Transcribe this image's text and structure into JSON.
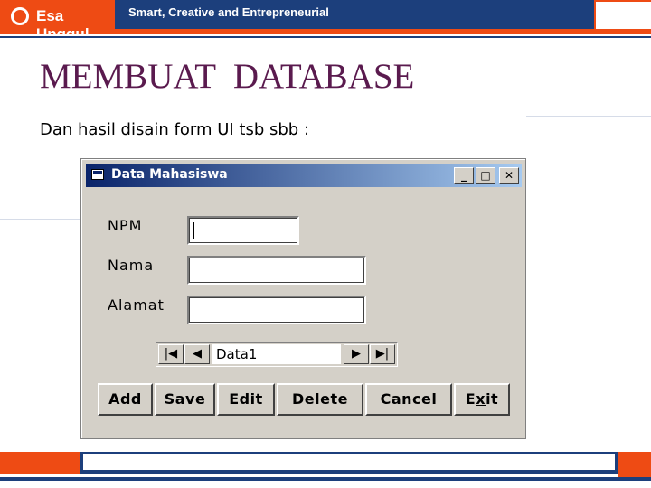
{
  "banner": {
    "logo_text": "Esa Unggul",
    "tagline": "Smart, Creative and Entrepreneurial"
  },
  "slide": {
    "title": "MEMBUAT  DATABASE",
    "body": "Dan hasil disain form UI tsb sbb :"
  },
  "window": {
    "title": "Data Mahasiswa",
    "controls": {
      "minimize": "_",
      "maximize": "□",
      "close": "✕"
    },
    "fields": [
      {
        "label": "NPM",
        "value": ""
      },
      {
        "label": "Nama",
        "value": ""
      },
      {
        "label": "Alamat",
        "value": ""
      }
    ],
    "data_control": {
      "caption": "Data1",
      "first": "|◀",
      "prev": "◀",
      "next": "▶",
      "last": "▶|"
    },
    "buttons": {
      "add": "Add",
      "save": "Save",
      "edit": "Edit",
      "delete": "Delete",
      "cancel": "Cancel",
      "exit_pre": "E",
      "exit_ul": "x",
      "exit_post": "it"
    }
  },
  "colors": {
    "brand_orange": "#ee4b14",
    "brand_navy": "#1c3f7c",
    "title_color": "#5a1a4e",
    "win_face": "#d4d0c8",
    "titlebar_start": "#0a246a"
  }
}
